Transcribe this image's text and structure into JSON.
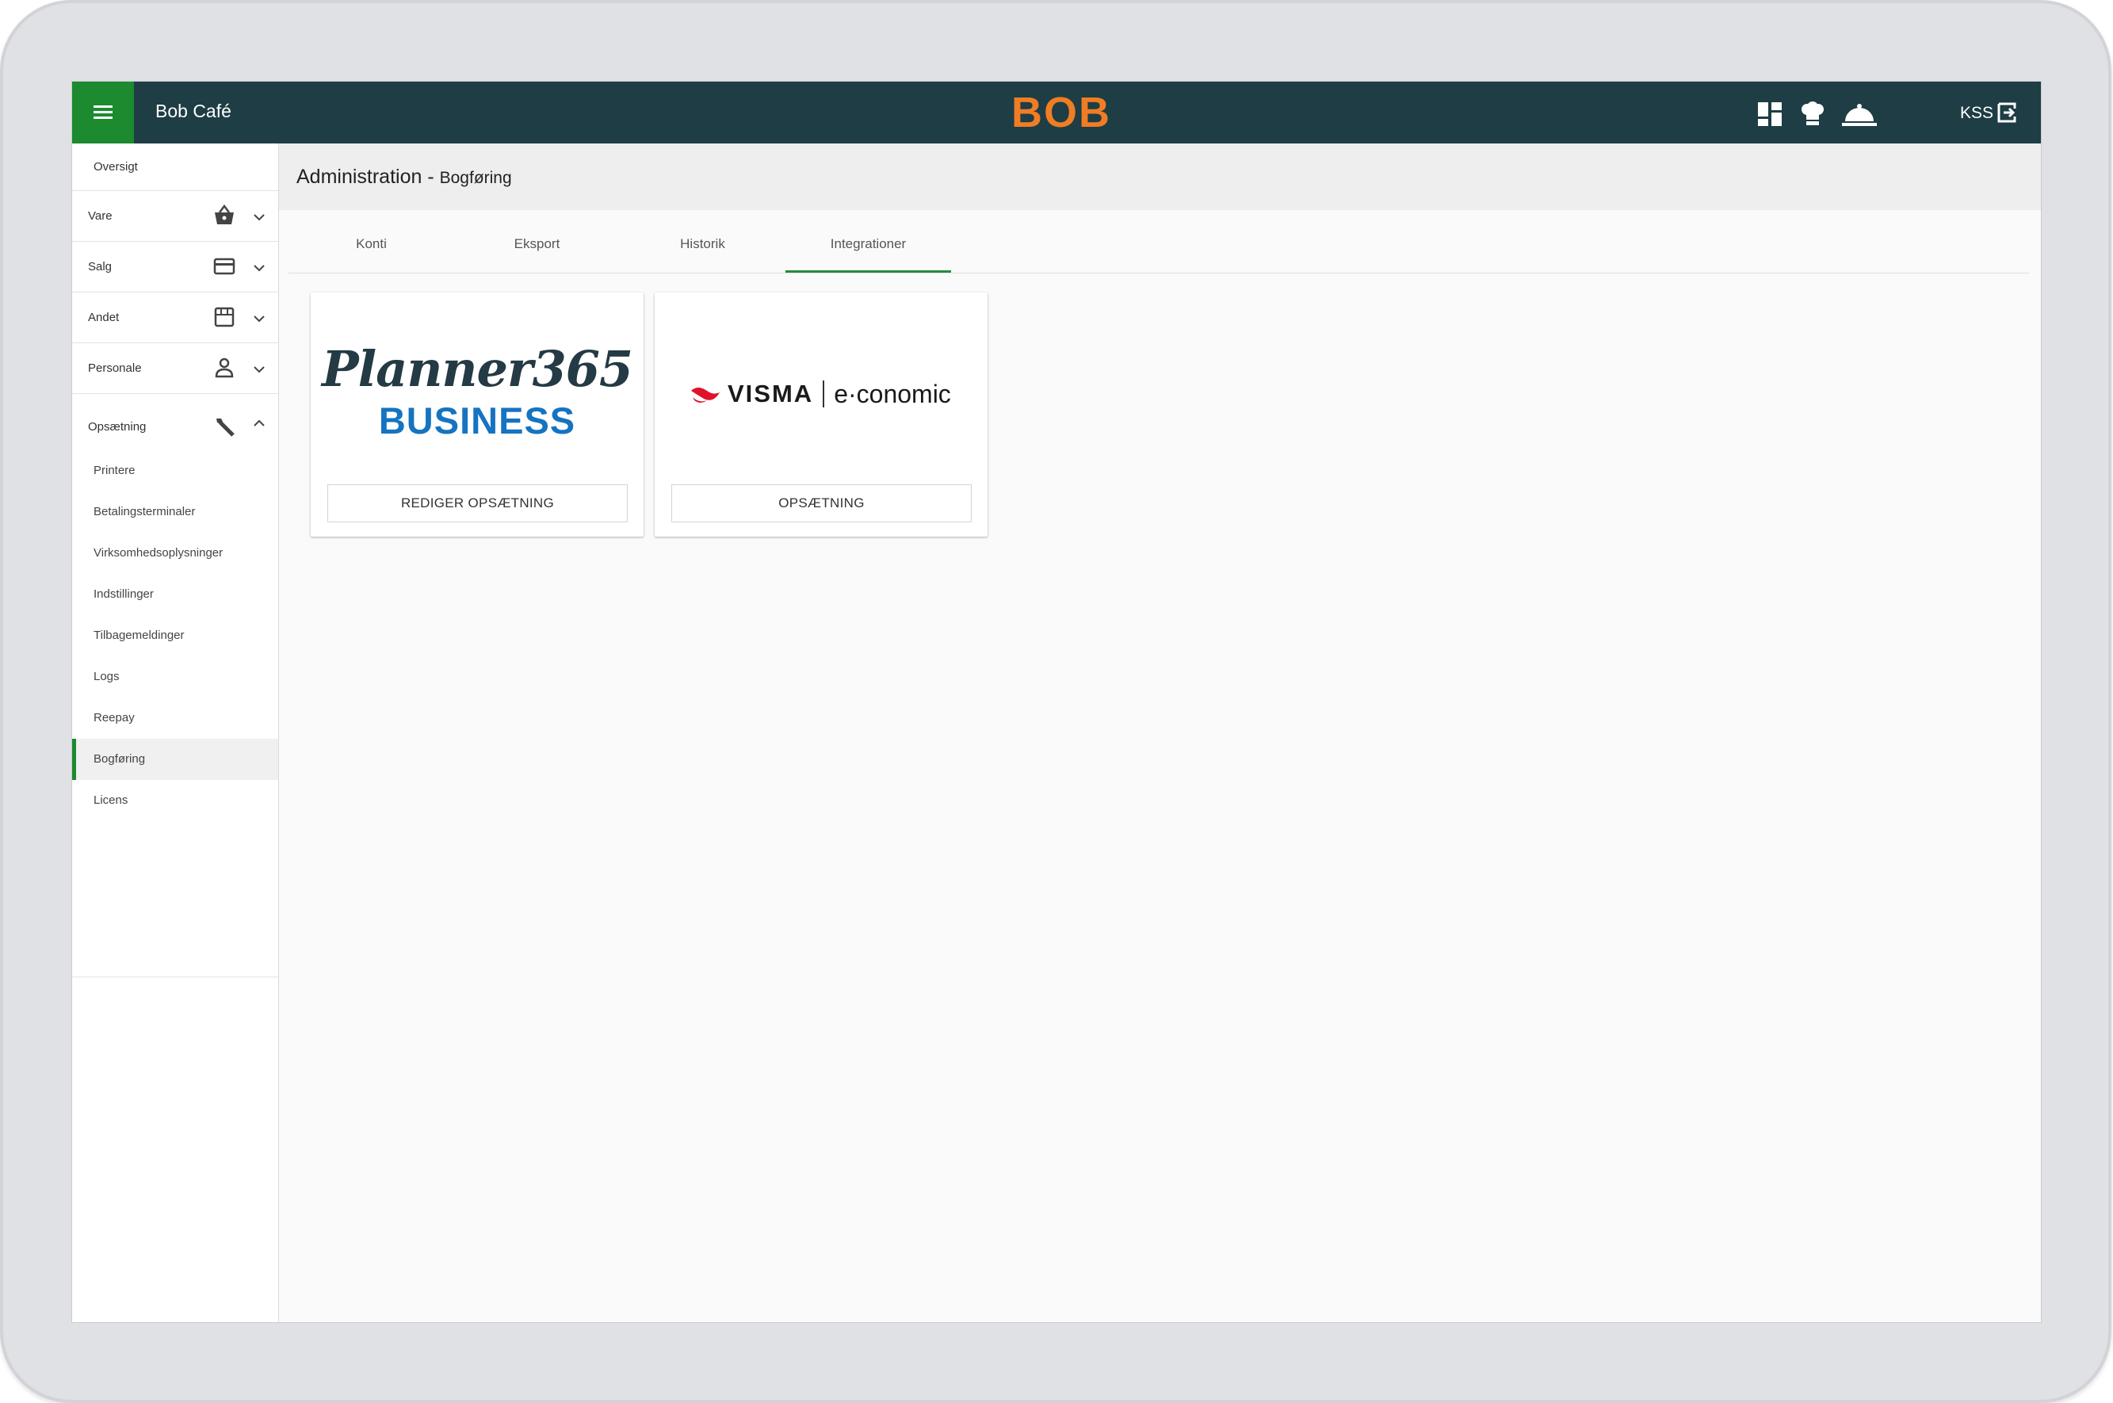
{
  "app": {
    "title": "Bob Café",
    "brand": "BOB",
    "user_code": "KSS",
    "top_icons": [
      "dashboard-icon",
      "chef-icon",
      "serving-bell-icon"
    ],
    "brand_color": "#f07d24",
    "accent_color": "#1c8a2e",
    "topbar_color": "#1e3d45"
  },
  "sidebar": {
    "items": [
      {
        "label": "Oversigt"
      },
      {
        "label": "Vare",
        "icon": "basket-icon"
      },
      {
        "label": "Salg",
        "icon": "credit-card-icon"
      },
      {
        "label": "Andet",
        "icon": "store-icon"
      },
      {
        "label": "Personale",
        "icon": "person-icon"
      },
      {
        "label": "Opsætning",
        "icon": "wrench-icon"
      }
    ],
    "subitems": [
      {
        "label": "Printere"
      },
      {
        "label": "Betalingsterminaler"
      },
      {
        "label": "Virksomhedsoplysninger"
      },
      {
        "label": "Indstillinger"
      },
      {
        "label": "Tilbagemeldinger"
      },
      {
        "label": "Logs"
      },
      {
        "label": "Reepay"
      },
      {
        "label": "Bogføring",
        "active": true
      },
      {
        "label": "Licens"
      }
    ]
  },
  "header": {
    "title": "Administration",
    "separator": " - ",
    "subtitle": "Bogføring"
  },
  "tabs": [
    {
      "label": "Konti"
    },
    {
      "label": "Eksport"
    },
    {
      "label": "Historik"
    },
    {
      "label": "Integrationer",
      "active": true
    }
  ],
  "integrations": [
    {
      "logo_line1": "Planner365",
      "logo_line2": "BUSINESS",
      "button": "REDIGER OPSÆTNING"
    },
    {
      "logo_brand": "VISMA",
      "logo_product": "e·conomic",
      "button": "OPSÆTNING"
    }
  ]
}
